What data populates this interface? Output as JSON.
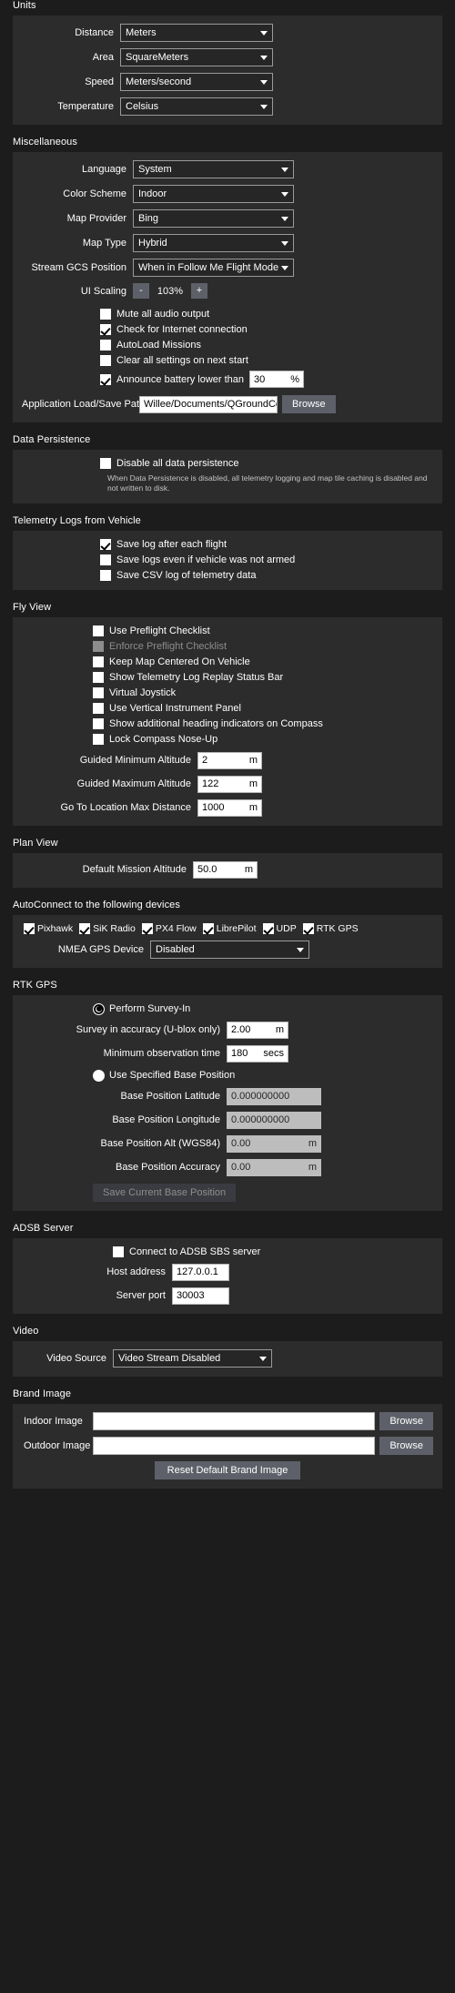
{
  "units": {
    "title": "Units",
    "rows": [
      {
        "label": "Distance",
        "value": "Meters"
      },
      {
        "label": "Area",
        "value": "SquareMeters"
      },
      {
        "label": "Speed",
        "value": "Meters/second"
      },
      {
        "label": "Temperature",
        "value": "Celsius"
      }
    ]
  },
  "misc": {
    "title": "Miscellaneous",
    "combos": [
      {
        "label": "Language",
        "value": "System"
      },
      {
        "label": "Color Scheme",
        "value": "Indoor"
      },
      {
        "label": "Map Provider",
        "value": "Bing"
      },
      {
        "label": "Map Type",
        "value": "Hybrid"
      },
      {
        "label": "Stream GCS Position",
        "value": "When in Follow Me Flight Mode"
      }
    ],
    "scaling": {
      "label": "UI Scaling",
      "minus": "-",
      "value": "103%",
      "plus": "+"
    },
    "checks": [
      {
        "label": "Mute all audio output",
        "checked": false
      },
      {
        "label": "Check for Internet connection",
        "checked": true
      },
      {
        "label": "AutoLoad Missions",
        "checked": false
      },
      {
        "label": "Clear all settings on next start",
        "checked": false
      }
    ],
    "battery": {
      "label": "Announce battery lower than",
      "checked": true,
      "value": "30",
      "unit": "%"
    },
    "load_save_path": {
      "label": "Application Load/Save Path",
      "value": "Willee/Documents/QGroundControl",
      "browse": "Browse"
    }
  },
  "data_persistence": {
    "title": "Data Persistence",
    "check": {
      "label": "Disable all data persistence",
      "checked": false
    },
    "note": "When Data Persistence is disabled, all telemetry logging and map tile caching is disabled and not written to disk."
  },
  "telemetry": {
    "title": "Telemetry Logs from Vehicle",
    "checks": [
      {
        "label": "Save log after each flight",
        "checked": true
      },
      {
        "label": "Save logs even if vehicle was not armed",
        "checked": false
      },
      {
        "label": "Save CSV log of telemetry data",
        "checked": false
      }
    ]
  },
  "fly_view": {
    "title": "Fly View",
    "checks": [
      {
        "label": "Use Preflight Checklist",
        "checked": false,
        "disabled": false
      },
      {
        "label": "Enforce Preflight Checklist",
        "checked": false,
        "disabled": true
      },
      {
        "label": "Keep Map Centered On Vehicle",
        "checked": false,
        "disabled": false
      },
      {
        "label": "Show Telemetry Log Replay Status Bar",
        "checked": false,
        "disabled": false
      },
      {
        "label": "Virtual Joystick",
        "checked": false,
        "disabled": false
      },
      {
        "label": "Use Vertical Instrument Panel",
        "checked": false,
        "disabled": false
      },
      {
        "label": "Show additional heading indicators on Compass",
        "checked": false,
        "disabled": false
      },
      {
        "label": "Lock Compass Nose-Up",
        "checked": false,
        "disabled": false
      }
    ],
    "fields": [
      {
        "label": "Guided Minimum Altitude",
        "value": "2",
        "unit": "m"
      },
      {
        "label": "Guided Maximum Altitude",
        "value": "122",
        "unit": "m"
      },
      {
        "label": "Go To Location Max Distance",
        "value": "1000",
        "unit": "m"
      }
    ]
  },
  "plan_view": {
    "title": "Plan View",
    "field": {
      "label": "Default Mission Altitude",
      "value": "50.0",
      "unit": "m"
    }
  },
  "autoconnect": {
    "title": "AutoConnect to the following devices",
    "devices": [
      {
        "label": "Pixhawk",
        "checked": true
      },
      {
        "label": "SiK Radio",
        "checked": true
      },
      {
        "label": "PX4 Flow",
        "checked": true
      },
      {
        "label": "LibrePilot",
        "checked": true
      },
      {
        "label": "UDP",
        "checked": true
      },
      {
        "label": "RTK GPS",
        "checked": true
      }
    ],
    "nmea": {
      "label": "NMEA GPS Device",
      "value": "Disabled"
    }
  },
  "rtk_gps": {
    "title": "RTK GPS",
    "survey_radio": {
      "label": "Perform Survey-In",
      "selected": true
    },
    "survey_fields": [
      {
        "label": "Survey in accuracy (U-blox only)",
        "value": "2.00",
        "unit": "m"
      },
      {
        "label": "Minimum observation time",
        "value": "180",
        "unit": "secs"
      }
    ],
    "base_radio": {
      "label": "Use Specified Base Position",
      "selected": false
    },
    "base_fields": [
      {
        "label": "Base Position Latitude",
        "value": "0.000000000",
        "unit": ""
      },
      {
        "label": "Base Position Longitude",
        "value": "0.000000000",
        "unit": ""
      },
      {
        "label": "Base Position Alt (WGS84)",
        "value": "0.00",
        "unit": "m"
      },
      {
        "label": "Base Position Accuracy",
        "value": "0.00",
        "unit": "m"
      }
    ],
    "save_button": "Save Current Base Position"
  },
  "adsb": {
    "title": "ADSB Server",
    "check": {
      "label": "Connect to ADSB SBS server",
      "checked": false
    },
    "fields": [
      {
        "label": "Host address",
        "value": "127.0.0.1"
      },
      {
        "label": "Server port",
        "value": "30003"
      }
    ]
  },
  "video": {
    "title": "Video",
    "field": {
      "label": "Video Source",
      "value": "Video Stream Disabled"
    }
  },
  "brand_image": {
    "title": "Brand Image",
    "rows": [
      {
        "label": "Indoor Image",
        "value": "",
        "browse": "Browse"
      },
      {
        "label": "Outdoor Image",
        "value": "",
        "browse": "Browse"
      }
    ],
    "reset": "Reset Default Brand Image"
  }
}
